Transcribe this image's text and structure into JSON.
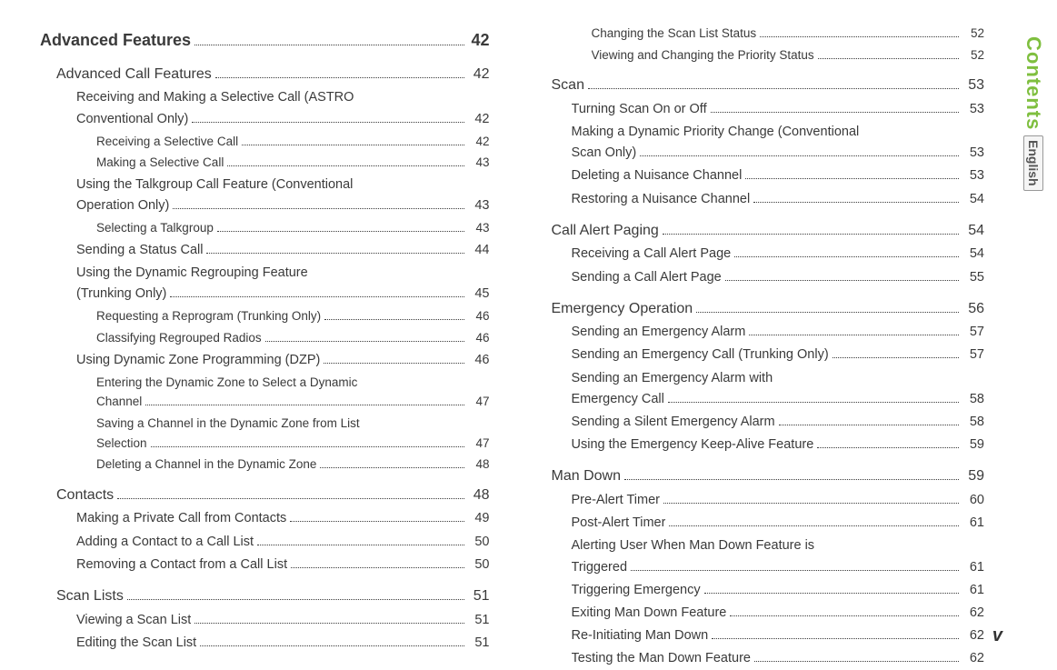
{
  "sideTab": {
    "contents": "Contents",
    "english": "English"
  },
  "footerPage": "v",
  "left": [
    {
      "lvl": 0,
      "label": "Advanced Features",
      "page": "42"
    },
    {
      "lvl": 1,
      "label": "Advanced Call Features",
      "page": "42"
    },
    {
      "lvl": 2,
      "wrap": true,
      "label1": "Receiving and Making a Selective Call (ASTRO",
      "label2": "Conventional Only)",
      "page": "42"
    },
    {
      "lvl": 3,
      "label": "Receiving a Selective Call",
      "page": "42"
    },
    {
      "lvl": 3,
      "label": "Making a Selective Call",
      "page": "43"
    },
    {
      "lvl": 2,
      "wrap": true,
      "label1": "Using the Talkgroup Call Feature (Conventional",
      "label2": "Operation Only)",
      "page": "43"
    },
    {
      "lvl": 3,
      "label": "Selecting a Talkgroup",
      "page": "43"
    },
    {
      "lvl": 2,
      "label": "Sending a Status Call",
      "page": "44"
    },
    {
      "lvl": 2,
      "wrap": true,
      "label1": "Using the Dynamic Regrouping Feature",
      "label2": "(Trunking Only)",
      "page": "45"
    },
    {
      "lvl": 3,
      "label": "Requesting a Reprogram (Trunking Only)",
      "page": "46"
    },
    {
      "lvl": 3,
      "label": "Classifying Regrouped Radios",
      "page": "46"
    },
    {
      "lvl": 2,
      "label": "Using Dynamic Zone Programming (DZP)",
      "page": "46"
    },
    {
      "lvl": 3,
      "wrap": true,
      "label1": "Entering the Dynamic Zone to Select a Dynamic",
      "label2": "Channel",
      "page": "47"
    },
    {
      "lvl": 3,
      "wrap": true,
      "label1": "Saving a Channel in the Dynamic Zone from List",
      "label2": "Selection",
      "page": "47"
    },
    {
      "lvl": 3,
      "label": "Deleting a Channel in the Dynamic Zone",
      "page": "48"
    },
    {
      "lvl": 1,
      "label": "Contacts",
      "page": "48"
    },
    {
      "lvl": 2,
      "label": "Making a Private Call from Contacts",
      "page": "49"
    },
    {
      "lvl": 2,
      "label": "Adding a Contact to a Call List",
      "page": "50"
    },
    {
      "lvl": 2,
      "label": "Removing a Contact from a Call List",
      "page": "50"
    },
    {
      "lvl": 1,
      "label": "Scan Lists",
      "page": "51"
    },
    {
      "lvl": 2,
      "label": "Viewing a Scan List",
      "page": "51"
    },
    {
      "lvl": 2,
      "label": "Editing the Scan List",
      "page": "51"
    }
  ],
  "right": [
    {
      "lvl": 3,
      "label": "Changing the Scan List Status",
      "page": "52"
    },
    {
      "lvl": 3,
      "label": "Viewing and Changing the Priority Status",
      "page": "52"
    },
    {
      "lvl": 1,
      "label": "Scan",
      "page": "53"
    },
    {
      "lvl": 2,
      "label": "Turning Scan On or Off",
      "page": "53"
    },
    {
      "lvl": 2,
      "wrap": true,
      "label1": "Making a Dynamic Priority Change (Conventional",
      "label2": "Scan Only)",
      "page": "53"
    },
    {
      "lvl": 2,
      "label": "Deleting a Nuisance Channel",
      "page": "53"
    },
    {
      "lvl": 2,
      "label": "Restoring a Nuisance Channel",
      "page": "54"
    },
    {
      "lvl": 1,
      "label": "Call Alert Paging",
      "page": "54"
    },
    {
      "lvl": 2,
      "label": "Receiving a Call Alert Page",
      "page": "54"
    },
    {
      "lvl": 2,
      "label": "Sending a Call Alert Page",
      "page": "55"
    },
    {
      "lvl": 1,
      "label": "Emergency Operation",
      "page": "56"
    },
    {
      "lvl": 2,
      "label": "Sending an Emergency Alarm",
      "page": "57"
    },
    {
      "lvl": 2,
      "label": "Sending an Emergency Call (Trunking Only)",
      "page": "57"
    },
    {
      "lvl": 2,
      "wrap": true,
      "label1": "Sending an Emergency Alarm with",
      "label2": "Emergency Call",
      "page": "58"
    },
    {
      "lvl": 2,
      "label": "Sending a Silent Emergency Alarm",
      "page": "58"
    },
    {
      "lvl": 2,
      "label": "Using the Emergency Keep-Alive Feature",
      "page": "59"
    },
    {
      "lvl": 1,
      "label": "Man Down",
      "page": "59"
    },
    {
      "lvl": 2,
      "label": "Pre-Alert Timer",
      "page": "60"
    },
    {
      "lvl": 2,
      "label": "Post-Alert Timer",
      "page": "61"
    },
    {
      "lvl": 2,
      "wrap": true,
      "label1": "Alerting User When Man Down Feature is",
      "label2": "Triggered",
      "page": "61"
    },
    {
      "lvl": 2,
      "label": "Triggering Emergency",
      "page": "61"
    },
    {
      "lvl": 2,
      "label": "Exiting Man Down Feature",
      "page": "62"
    },
    {
      "lvl": 2,
      "label": "Re-Initiating Man Down",
      "page": "62"
    },
    {
      "lvl": 2,
      "label": "Testing the Man Down Feature",
      "page": "62"
    }
  ]
}
